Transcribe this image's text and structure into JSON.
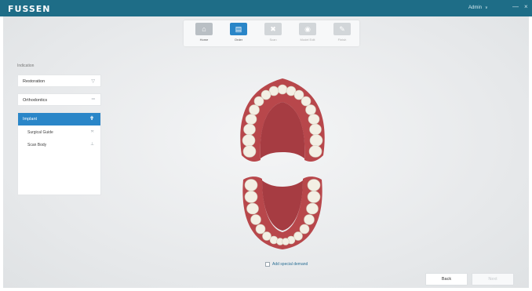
{
  "app": {
    "logo": "FUSSEN",
    "user": "Admin",
    "minimize_glyph": "—",
    "close_glyph": "×"
  },
  "toolbar": {
    "items": [
      {
        "label": "Home",
        "icon": "home-icon",
        "state": "normal"
      },
      {
        "label": "Order",
        "icon": "order-icon",
        "state": "active"
      },
      {
        "label": "Scan",
        "icon": "scan-icon",
        "state": "disabled"
      },
      {
        "label": "Model Edit",
        "icon": "model-edit-icon",
        "state": "disabled"
      },
      {
        "label": "Finish",
        "icon": "finish-icon",
        "state": "disabled"
      }
    ]
  },
  "indication": {
    "title": "Indication",
    "items": [
      {
        "label": "Restoration",
        "icon": "restoration-icon"
      },
      {
        "label": "Orthodontics",
        "icon": "orthodontics-icon"
      }
    ],
    "implant": {
      "label": "Implant",
      "icon": "implant-icon",
      "sub_items": [
        {
          "label": "Surgical Guide",
          "icon": "surgical-guide-icon"
        },
        {
          "label": "Scan Body",
          "icon": "scan-body-icon"
        }
      ]
    }
  },
  "special_demand": {
    "label": "Add special demand",
    "checked": false
  },
  "footer": {
    "back_label": "Back",
    "next_label": "Next"
  },
  "colors": {
    "titlebar": "#1e6d87",
    "accent": "#2a86c8",
    "gum": "#b8474b",
    "tooth": "#f3efe4"
  }
}
